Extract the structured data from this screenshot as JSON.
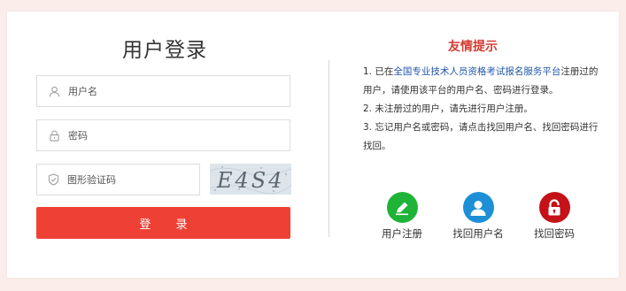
{
  "login": {
    "title": "用户登录",
    "username_placeholder": "用户名",
    "password_placeholder": "密码",
    "captcha_placeholder": "图形验证码",
    "captcha_text": "E4S4",
    "submit_label": "登 录"
  },
  "tips": {
    "title": "友情提示",
    "item1_prefix": "1. 已在",
    "item1_link": "全国专业技术人员资格考试报名服务平台",
    "item1_suffix": "注册过的用户，请使用该平台的用户名、密码进行登录。",
    "item2": "2. 未注册过的用户，请先进行用户注册。",
    "item3": "3. 忘记用户名或密码，请点击找回用户名、找回密码进行找回。",
    "link_color": "#2255aa",
    "title_color": "#d33c33"
  },
  "actions": [
    {
      "label": "用户注册",
      "icon": "pencil-icon",
      "color": "#1fb338"
    },
    {
      "label": "找回用户名",
      "icon": "user-icon",
      "color": "#1d8fd6"
    },
    {
      "label": "找回密码",
      "icon": "lock-icon",
      "color": "#c41218"
    }
  ],
  "theme": {
    "accent": "#ef4035",
    "background": "#fbeeea"
  }
}
